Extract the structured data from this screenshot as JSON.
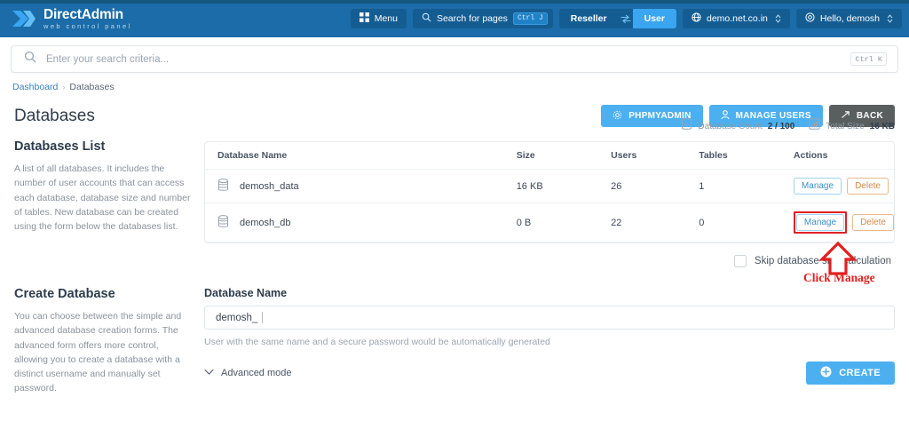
{
  "header": {
    "logo_title_bold": "Direct",
    "logo_title_light": "Admin",
    "logo_subtitle": "web control panel",
    "menu_label": "Menu",
    "search_pages_label": "Search for pages",
    "search_pages_shortcut": "Ctrl J",
    "reseller_label": "Reseller",
    "user_label": "User",
    "domain_label": "demo.net.co.in",
    "account_label": "Hello, demosh",
    "accent_color": "#1b6ca8",
    "active_toggle_color": "#3aa5f0"
  },
  "search": {
    "placeholder": "Enter your search criteria...",
    "shortcut": "Ctrl K"
  },
  "breadcrumb": {
    "root": "Dashboard",
    "separator": "›",
    "current": "Databases"
  },
  "page": {
    "title": "Databases",
    "buttons": {
      "phpmyadmin": "PHPMYADMIN",
      "manage_users": "MANAGE USERS",
      "back": "BACK"
    }
  },
  "databases_list": {
    "heading": "Databases List",
    "description": "A list of all databases. It includes the number of user accounts that can access each database, database size and number of tables. New database can be created using the form below the databases list.",
    "stats": {
      "count_label": "Database Count",
      "count_value": "2 / 100",
      "size_label": "Total Size",
      "size_value": "16 KB"
    },
    "columns": [
      "Database Name",
      "Size",
      "Users",
      "Tables",
      "Actions"
    ],
    "rows": [
      {
        "name": "demosh_data",
        "size": "16 KB",
        "users": "26",
        "tables": "1",
        "manage": "Manage",
        "delete": "Delete",
        "highlighted": false
      },
      {
        "name": "demosh_db",
        "size": "0 B",
        "users": "22",
        "tables": "0",
        "manage": "Manage",
        "delete": "Delete",
        "highlighted": true
      }
    ],
    "skip_checkbox_label": "Skip database size calculation"
  },
  "annotation": {
    "text": "Click Manage",
    "color": "#e02020"
  },
  "create_database": {
    "heading": "Create Database",
    "description": "You can choose between the simple and advanced database creation forms. The advanced form offers more control, allowing you to create a database with a distinct username and manually set password.",
    "field_label": "Database Name",
    "field_value": "demosh_",
    "hint": "User with the same name and a secure password would be automatically generated",
    "advanced_mode_label": "Advanced mode",
    "create_button": "CREATE"
  }
}
